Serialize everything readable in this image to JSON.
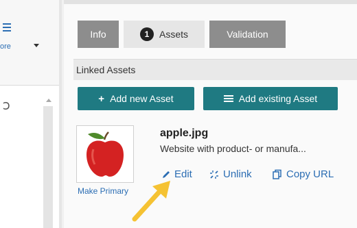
{
  "sidebar": {
    "more_label": "ore",
    "tree_node_glyph": "Ↄ"
  },
  "tabs": {
    "info": "Info",
    "assets_count": "1",
    "assets": "Assets",
    "validation": "Validation"
  },
  "linked_assets": {
    "header": "Linked Assets",
    "add_new": "Add new Asset",
    "add_existing": "Add existing Asset"
  },
  "asset": {
    "filename": "apple.jpg",
    "description": "Website with product- or manufa...",
    "make_primary": "Make Primary",
    "edit": "Edit",
    "unlink": "Unlink",
    "copy_url": "Copy URL"
  },
  "colors": {
    "accent_button": "#1f7a82",
    "link": "#2b6db3",
    "tab_inactive": "#8d8d8d",
    "tab_active": "#e6e6e6",
    "arrow": "#f5c233"
  }
}
